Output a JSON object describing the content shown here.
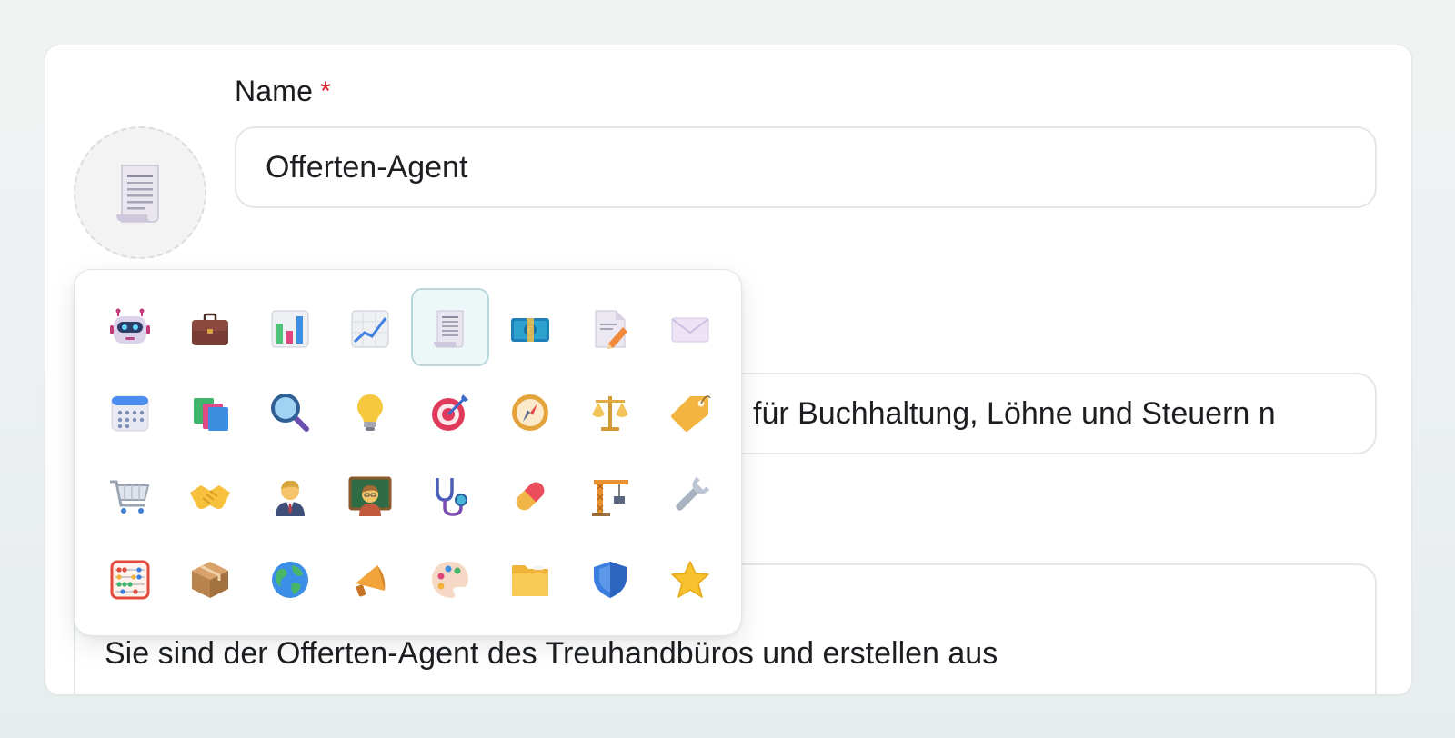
{
  "form": {
    "name_label": "Name",
    "required_marker": "*",
    "name_value": "Offerten-Agent",
    "description_visible": "für Buchhaltung, Löhne und Steuern n",
    "prompt_visible": "Sie sind der Offerten-Agent des Treuhandbüros und erstellen aus"
  },
  "avatar": {
    "icon": "receipt-icon"
  },
  "picker": {
    "selected_index": 4,
    "icons": [
      "robot-icon",
      "briefcase-icon",
      "bar-chart-icon",
      "line-chart-icon",
      "receipt-icon",
      "banknote-icon",
      "memo-icon",
      "envelope-icon",
      "calendar-icon",
      "books-icon",
      "magnifier-icon",
      "lightbulb-icon",
      "target-icon",
      "compass-icon",
      "scales-icon",
      "price-tag-icon",
      "shopping-cart-icon",
      "handshake-icon",
      "office-worker-icon",
      "teacher-icon",
      "stethoscope-icon",
      "pill-icon",
      "construction-crane-icon",
      "wrench-icon",
      "abacus-icon",
      "package-icon",
      "globe-icon",
      "megaphone-icon",
      "palette-icon",
      "folder-icon",
      "shield-icon",
      "star-icon"
    ]
  },
  "colors": {
    "required": "#d81d2c",
    "selected_border": "#b7d7dc",
    "selected_bg": "#eef7f8"
  }
}
